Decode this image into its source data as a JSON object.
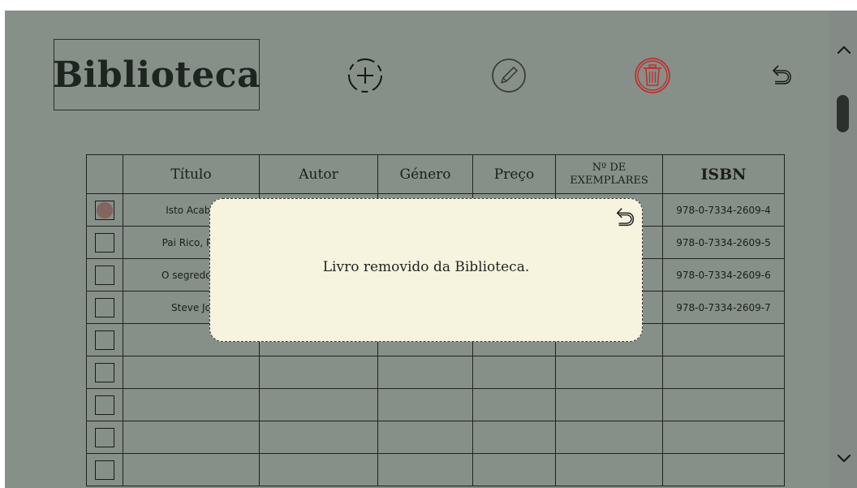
{
  "app": {
    "title": "Biblioteca"
  },
  "toolbar": {
    "add_icon": "circle-plus",
    "edit_icon": "pencil-circle",
    "delete_icon": "trash",
    "undo_icon": "undo-arrow"
  },
  "colors": {
    "background": "#878f89",
    "delete_accent": "#c0302e",
    "dialog_background": "#f6f4df",
    "selected_dot": "#82655c"
  },
  "table": {
    "columns": [
      "Título",
      "Autor",
      "Género",
      "Preço",
      "Nº DE EXEMPLARES",
      "ISBN"
    ],
    "rows": [
      {
        "selected": true,
        "titulo": "Isto Acaba ",
        "autor": "",
        "genero": "",
        "preco": "",
        "exemplares": "",
        "isbn": "978-0-7334-2609-4"
      },
      {
        "selected": false,
        "titulo": "Pai Rico, Pai ",
        "autor": "",
        "genero": "",
        "preco": "",
        "exemplares": "",
        "isbn": "978-0-7334-2609-5"
      },
      {
        "selected": false,
        "titulo": "O segredo d",
        "autor": "",
        "genero": "",
        "preco": "",
        "exemplares": "",
        "isbn": "978-0-7334-2609-6"
      },
      {
        "selected": false,
        "titulo": "Steve Jo",
        "autor": "",
        "genero": "",
        "preco": "",
        "exemplares": "",
        "isbn": "978-0-7334-2609-7"
      },
      {
        "selected": false,
        "titulo": "",
        "autor": "",
        "genero": "",
        "preco": "",
        "exemplares": "",
        "isbn": ""
      },
      {
        "selected": false,
        "titulo": "",
        "autor": "",
        "genero": "",
        "preco": "",
        "exemplares": "",
        "isbn": ""
      },
      {
        "selected": false,
        "titulo": "",
        "autor": "",
        "genero": "",
        "preco": "",
        "exemplares": "",
        "isbn": ""
      },
      {
        "selected": false,
        "titulo": "",
        "autor": "",
        "genero": "",
        "preco": "",
        "exemplares": "",
        "isbn": ""
      },
      {
        "selected": false,
        "titulo": "",
        "autor": "",
        "genero": "",
        "preco": "",
        "exemplares": "",
        "isbn": ""
      }
    ]
  },
  "dialog": {
    "message": "Livro removido da Biblioteca.",
    "back_icon": "undo-arrow"
  },
  "scrollbar": {
    "up_icon": "chevron-up",
    "down_icon": "chevron-down"
  }
}
